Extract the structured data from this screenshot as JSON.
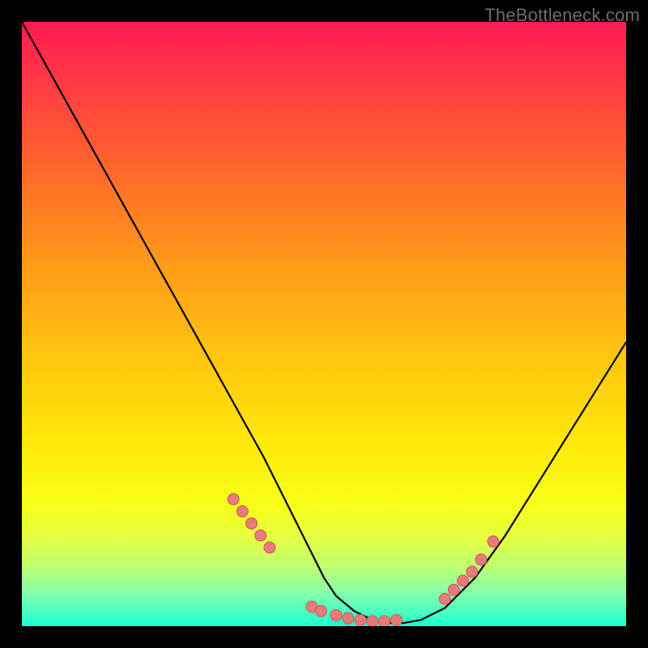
{
  "watermark": "TheBottleneck.com",
  "colors": {
    "page_bg": "#000000",
    "curve": "#000000",
    "marker": "#e97a7a",
    "marker_stroke": "#c85a5a"
  },
  "chart_data": {
    "type": "line",
    "title": "",
    "xlabel": "",
    "ylabel": "",
    "xlim": [
      0,
      100
    ],
    "ylim": [
      0,
      100
    ],
    "grid": false,
    "legend": false,
    "series": [
      {
        "name": "bottleneck-curve",
        "x": [
          0,
          5,
          10,
          15,
          20,
          25,
          30,
          35,
          40,
          45,
          48,
          50,
          52,
          55,
          58,
          60,
          63,
          66,
          70,
          75,
          80,
          85,
          90,
          95,
          100
        ],
        "y": [
          100,
          91,
          82,
          73,
          64,
          55,
          46,
          37,
          28,
          18,
          12,
          8,
          5,
          2.5,
          1,
          0.5,
          0.5,
          1,
          3,
          8,
          15,
          23,
          31,
          39,
          47
        ]
      }
    ],
    "markers": {
      "name": "highlighted-points",
      "x": [
        35,
        36.5,
        38,
        39.5,
        41,
        48,
        49.5,
        52,
        54,
        56,
        58,
        60,
        62,
        70,
        71.5,
        73,
        74.5,
        76,
        78
      ],
      "y": [
        21,
        19,
        17,
        15,
        13,
        3.2,
        2.5,
        1.8,
        1.3,
        1.0,
        0.8,
        0.8,
        1.0,
        4.5,
        6,
        7.5,
        9,
        11,
        14
      ]
    }
  }
}
